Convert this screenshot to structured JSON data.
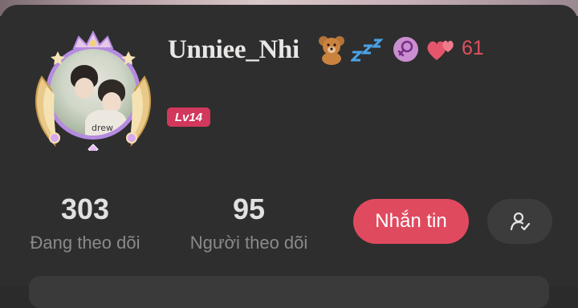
{
  "profile": {
    "username": "Unniee_Nhi",
    "heart_count": "61",
    "level": "Lv14",
    "icons": [
      "bear-emoji",
      "zzz-emoji",
      "female-gender-icon",
      "two-hearts-icon"
    ],
    "avatar_shirt_text": "drew"
  },
  "stats": {
    "following_count": "303",
    "following_label": "Đang theo dõi",
    "followers_count": "95",
    "followers_label": "Người theo dõi"
  },
  "actions": {
    "message_label": "Nhắn tin",
    "follow_icon": "user-check-icon"
  },
  "colors": {
    "background": "#2e2e2e",
    "accent": "#e04a5f",
    "level_badge": "#d2375c",
    "heart_count": "#e2505e",
    "gender_badge": "#c98fd0"
  }
}
